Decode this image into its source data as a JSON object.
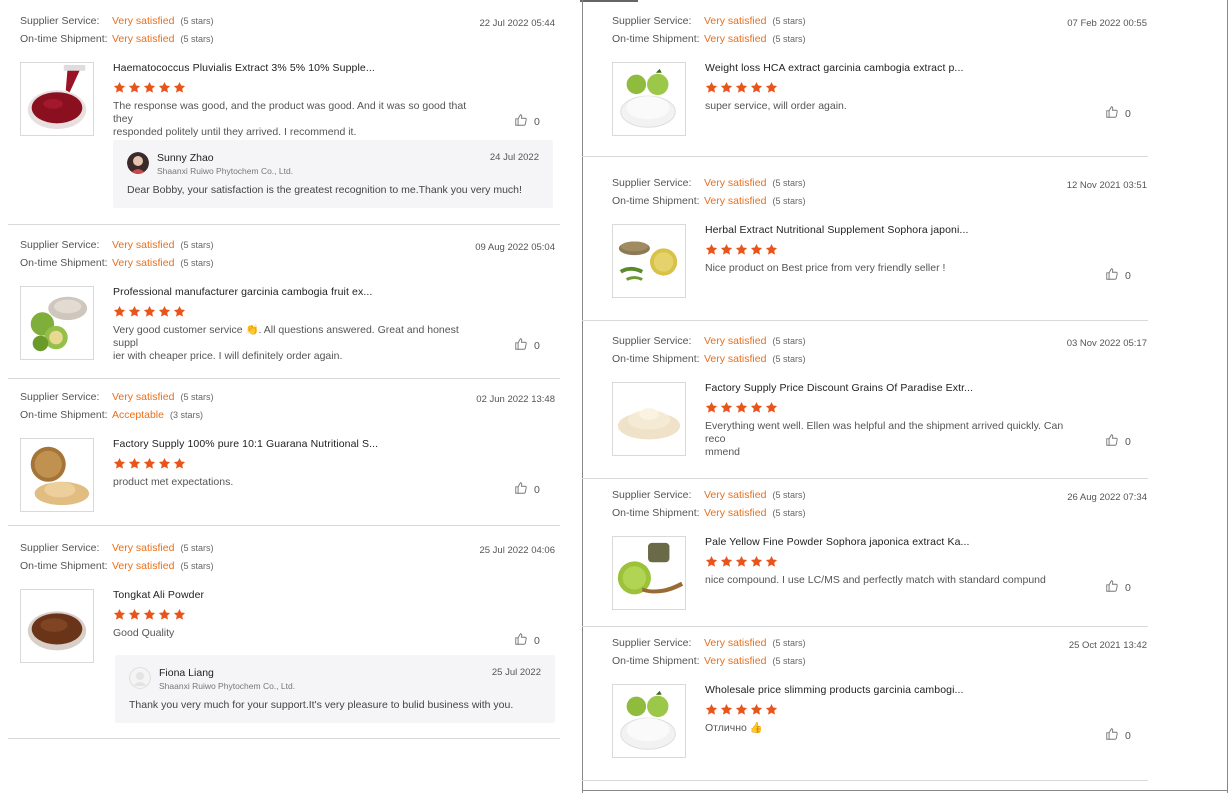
{
  "labels": {
    "supplier_service": "Supplier Service:",
    "ontime_shipment": "On-time Shipment:"
  },
  "colors": {
    "accent": "#e8701a",
    "star": "#e8541a"
  },
  "left": [
    {
      "supplier_rating": "Very satisfied",
      "supplier_stars": "(5 stars)",
      "shipment_rating": "Very satisfied",
      "shipment_stars": "(5 stars)",
      "date": "22 Jul 2022 05:44",
      "product": "Haematococcus Pluvialis Extract 3% 5% 10% Supple...",
      "thumb_icon": "red-liquid-icon",
      "rating": 5,
      "comment_lines": [
        "The response was good, and the product was good.  And it was so good that they",
        "responded politely until they arrived.  I recommend it."
      ],
      "likes": "0",
      "reply": {
        "name": "Sunny Zhao",
        "company": "Shaanxi Ruiwo Phytochem Co., Ltd.",
        "date": "24 Jul 2022",
        "text": "Dear Bobby, your satisfaction is the greatest recognition to me.Thank you very much!"
      }
    },
    {
      "supplier_rating": "Very satisfied",
      "supplier_stars": "(5 stars)",
      "shipment_rating": "Very satisfied",
      "shipment_stars": "(5 stars)",
      "date": "09 Aug 2022 05:04",
      "product": "Professional manufacturer garcinia cambogia fruit ex...",
      "thumb_icon": "garcinia-fruit-icon",
      "rating": 5,
      "comment_lines": [
        "Very good customer service 👏.  All questions answered.  Great and honest suppl",
        "ier with cheaper price. I will definitely order again."
      ],
      "likes": "0"
    },
    {
      "supplier_rating": "Very satisfied",
      "supplier_stars": "(5 stars)",
      "shipment_rating": "Acceptable",
      "shipment_stars": "(3 stars)",
      "date": "02 Jun 2022 13:48",
      "product": "Factory Supply 100% pure 10:1 Guarana Nutritional S...",
      "thumb_icon": "powder-icon",
      "rating": 5,
      "comment_lines": [
        "product met expectations."
      ],
      "likes": "0"
    },
    {
      "supplier_rating": "Very satisfied",
      "supplier_stars": "(5 stars)",
      "shipment_rating": "Very satisfied",
      "shipment_stars": "(5 stars)",
      "date": "25 Jul 2022 04:06",
      "product": "Tongkat Ali Powder",
      "thumb_icon": "brown-powder-icon",
      "rating": 5,
      "comment_lines": [
        "Good Quality"
      ],
      "likes": "0",
      "reply": {
        "name": "Fiona Liang",
        "company": "Shaanxi Ruiwo Phytochem Co., Ltd.",
        "date": "25 Jul 2022",
        "text": "Thank you very much for your support.It's very pleasure to bulid business with you."
      }
    }
  ],
  "right": [
    {
      "supplier_rating": "Very satisfied",
      "supplier_stars": "(5 stars)",
      "shipment_rating": "Very satisfied",
      "shipment_stars": "(5 stars)",
      "date": "07 Feb 2022 00:55",
      "product": "Weight loss HCA extract garcinia cambogia extract p...",
      "thumb_icon": "garcinia-powder-icon",
      "rating": 5,
      "comment_lines": [
        "super service, will order again."
      ],
      "likes": "0"
    },
    {
      "supplier_rating": "Very satisfied",
      "supplier_stars": "(5 stars)",
      "shipment_rating": "Very satisfied",
      "shipment_stars": "(5 stars)",
      "date": "12 Nov 2021 03:51",
      "product": "Herbal Extract Nutritional Supplement Sophora japoni...",
      "thumb_icon": "herbal-bowl-icon",
      "rating": 5,
      "comment_lines": [
        "Nice product on Best price from very friendly seller !"
      ],
      "likes": "0"
    },
    {
      "supplier_rating": "Very satisfied",
      "supplier_stars": "(5 stars)",
      "shipment_rating": "Very satisfied",
      "shipment_stars": "(5 stars)",
      "date": "03 Nov 2022 05:17",
      "product": "Factory Supply Price Discount Grains Of Paradise Extr...",
      "thumb_icon": "light-powder-icon",
      "rating": 5,
      "comment_lines": [
        "Everything went well. Ellen was helpful and the shipment arrived quickly. Can reco",
        "mmend"
      ],
      "likes": "0"
    },
    {
      "supplier_rating": "Very satisfied",
      "supplier_stars": "(5 stars)",
      "shipment_rating": "Very satisfied",
      "shipment_stars": "(5 stars)",
      "date": "26 Aug 2022 07:34",
      "product": "Pale Yellow Fine Powder Sophora japonica extract Ka...",
      "thumb_icon": "green-powder-spoon-icon",
      "rating": 5,
      "comment_lines": [
        "nice compound. I use LC/MS and perfectly match with standard compund"
      ],
      "likes": "0"
    },
    {
      "supplier_rating": "Very satisfied",
      "supplier_stars": "(5 stars)",
      "shipment_rating": "Very satisfied",
      "shipment_stars": "(5 stars)",
      "date": "25 Oct 2021 13:42",
      "product": "Wholesale price slimming products garcinia cambogi...",
      "thumb_icon": "garcinia-powder-icon",
      "rating": 5,
      "comment_lines": [
        "Отлично 👍"
      ],
      "likes": "0"
    }
  ]
}
